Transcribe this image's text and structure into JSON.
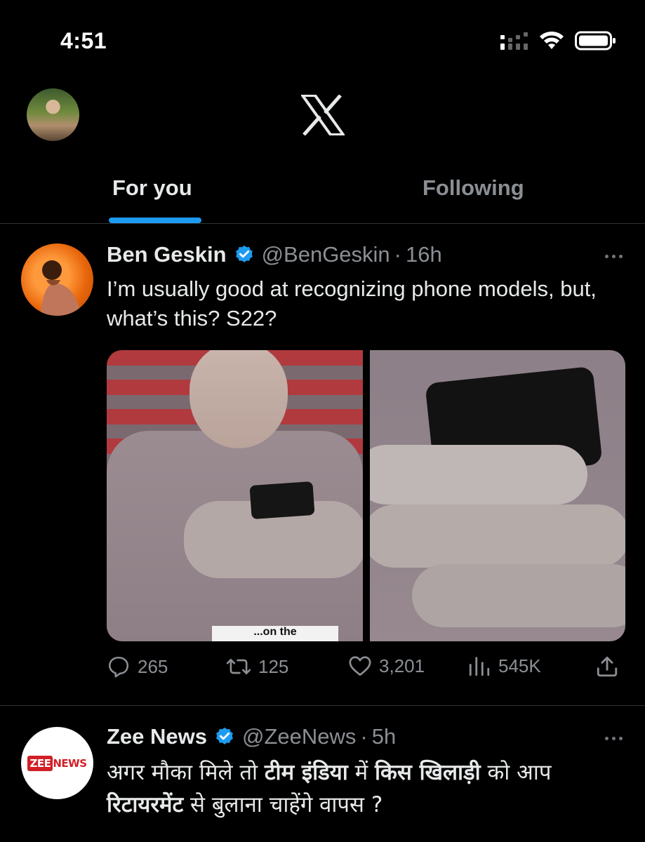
{
  "status_bar": {
    "time": "4:51"
  },
  "header": {
    "logo": "x-logo",
    "avatar": "profile-avatar"
  },
  "tabs": [
    {
      "label": "For you",
      "active": true
    },
    {
      "label": "Following",
      "active": false
    }
  ],
  "colors": {
    "accent": "#1d9bf0",
    "background": "#000000",
    "text_primary": "#e7e9ea",
    "text_secondary": "#8b8f94",
    "divider": "#2f3336"
  },
  "tweets": [
    {
      "name": "Ben Geskin",
      "verified": true,
      "handle": "@BenGeskin",
      "separator": "·",
      "time": "16h",
      "text": "I’m usually good at recognizing phone models, but, what’s this? S22?",
      "media_caption_fragment": "...on the",
      "stats": {
        "replies": "265",
        "reposts": "125",
        "likes": "3,201",
        "views": "545K"
      }
    },
    {
      "name": "Zee News",
      "verified": true,
      "handle": "@ZeeNews",
      "separator": "·",
      "time": "5h",
      "avatar_logo": {
        "zee": "ZEE",
        "news": "NEWS"
      },
      "text_segments": [
        {
          "text": "अगर मौका मिले तो ",
          "bold": false
        },
        {
          "text": "टीम इंडिया",
          "bold": true
        },
        {
          "text": " में ",
          "bold": false
        },
        {
          "text": "किस खिलाड़ी",
          "bold": true
        },
        {
          "text": " को आप ",
          "bold": false
        },
        {
          "text": "रिटायरमेंट",
          "bold": true
        },
        {
          "text": " से बुलाना चाहेंगे वापस ?",
          "bold": false
        }
      ]
    }
  ]
}
